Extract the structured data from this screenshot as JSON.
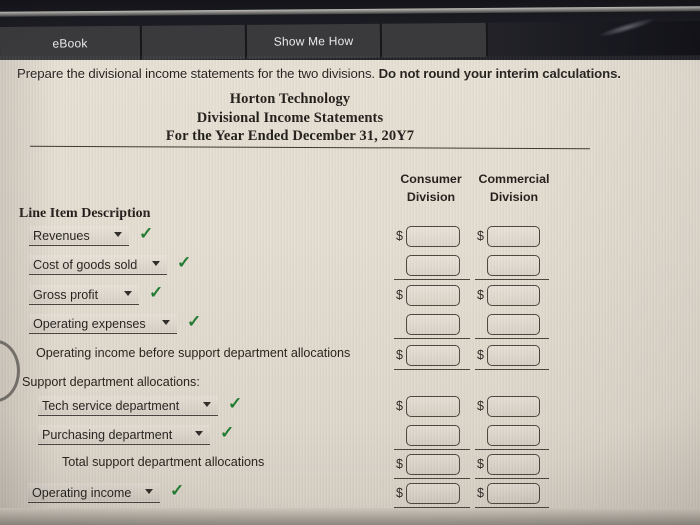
{
  "toolbar": {
    "tabs": [
      {
        "label": "eBook",
        "name": "tab-ebook"
      },
      {
        "label": "",
        "name": "tab-blank-1"
      },
      {
        "label": "Show Me How",
        "name": "tab-show-me-how"
      },
      {
        "label": "",
        "name": "tab-blank-2"
      }
    ]
  },
  "instruction": {
    "text": "Prepare the divisional income statements for the two divisions. ",
    "emphasis": "Do not round your interim calculations."
  },
  "statement": {
    "company": "Horton Technology",
    "title": "Divisional Income Statements",
    "period": "For the Year Ended December 31, 20Y7",
    "line_item_header": "Line Item Description",
    "columns": [
      {
        "line1": "Consumer",
        "line2": "Division"
      },
      {
        "line1": "Commercial",
        "line2": "Division"
      }
    ]
  },
  "colors": {
    "check_green": "#1f7a2e",
    "page_bg": "#e4ddd1",
    "ink": "#221f1b",
    "toolbar_bg": "#3a3a3c"
  },
  "rows": [
    {
      "kind": "select",
      "label": "Revenues",
      "select_width": 100,
      "checked": true,
      "check_symbol": "✓",
      "consumer": {
        "dollar": "$",
        "value": ""
      },
      "commercial": {
        "dollar": "$",
        "value": ""
      },
      "rule_below": "none"
    },
    {
      "kind": "select",
      "label": "Cost of goods sold",
      "select_width": 138,
      "checked": true,
      "check_symbol": "✓",
      "consumer": {
        "dollar": "",
        "value": ""
      },
      "commercial": {
        "dollar": "",
        "value": ""
      },
      "rule_below": "single"
    },
    {
      "kind": "select",
      "label": "Gross profit",
      "select_width": 110,
      "checked": true,
      "check_symbol": "✓",
      "consumer": {
        "dollar": "$",
        "value": ""
      },
      "commercial": {
        "dollar": "$",
        "value": ""
      },
      "rule_below": "none"
    },
    {
      "kind": "select",
      "label": "Operating expenses",
      "select_width": 148,
      "checked": true,
      "check_symbol": "✓",
      "consumer": {
        "dollar": "",
        "value": ""
      },
      "commercial": {
        "dollar": "",
        "value": ""
      },
      "rule_below": "single"
    },
    {
      "kind": "text",
      "label": "Operating income before support department allocations",
      "indent": 36,
      "consumer": {
        "dollar": "$",
        "value": ""
      },
      "commercial": {
        "dollar": "$",
        "value": ""
      },
      "rule_below": "single"
    },
    {
      "kind": "text",
      "label": "Support department allocations:",
      "indent": 22,
      "consumer": null,
      "commercial": null,
      "rule_below": "none"
    },
    {
      "kind": "select",
      "label": "Tech service department",
      "select_width": 180,
      "checked": true,
      "check_symbol": "✓",
      "indent": 38,
      "consumer": {
        "dollar": "$",
        "value": ""
      },
      "commercial": {
        "dollar": "$",
        "value": ""
      },
      "rule_below": "none"
    },
    {
      "kind": "select",
      "label": "Purchasing department",
      "select_width": 172,
      "checked": true,
      "check_symbol": "✓",
      "indent": 38,
      "consumer": {
        "dollar": "",
        "value": ""
      },
      "commercial": {
        "dollar": "",
        "value": ""
      },
      "rule_below": "single"
    },
    {
      "kind": "text",
      "label": "Total support department allocations",
      "indent": 62,
      "consumer": {
        "dollar": "$",
        "value": ""
      },
      "commercial": {
        "dollar": "$",
        "value": ""
      },
      "rule_below": "single"
    },
    {
      "kind": "select",
      "label": "Operating income",
      "select_width": 132,
      "checked": true,
      "check_symbol": "✓",
      "indent": 28,
      "consumer": {
        "dollar": "$",
        "value": ""
      },
      "commercial": {
        "dollar": "$",
        "value": ""
      },
      "rule_below": "double"
    }
  ]
}
